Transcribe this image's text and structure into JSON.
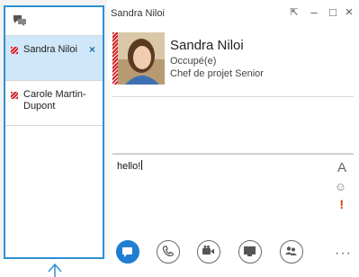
{
  "window": {
    "title": "Sandra Niloi",
    "buttons": {
      "pin": "⇱",
      "minimize": "–",
      "maximize": "□",
      "close": "×"
    }
  },
  "sidebar": {
    "conversations": [
      {
        "name": "Sandra Niloi",
        "status_color": "#d2232a",
        "selected": true,
        "close_label": "×"
      },
      {
        "name": "Carole Martin-Dupont",
        "status_color": "#d2232a",
        "selected": false
      }
    ]
  },
  "contact": {
    "name": "Sandra Niloi",
    "status": "Occupé(e)",
    "title": "Chef de projet Senior",
    "status_color": "#d2232a"
  },
  "compose": {
    "text": "hello!",
    "font_label": "A",
    "emoji_label": "☺",
    "important_label": "!"
  },
  "toolbar": {
    "items": [
      "im-icon",
      "phone-icon",
      "video-icon",
      "present-icon",
      "participants-icon"
    ],
    "more_label": "···",
    "accent": "#1f7ecf"
  }
}
